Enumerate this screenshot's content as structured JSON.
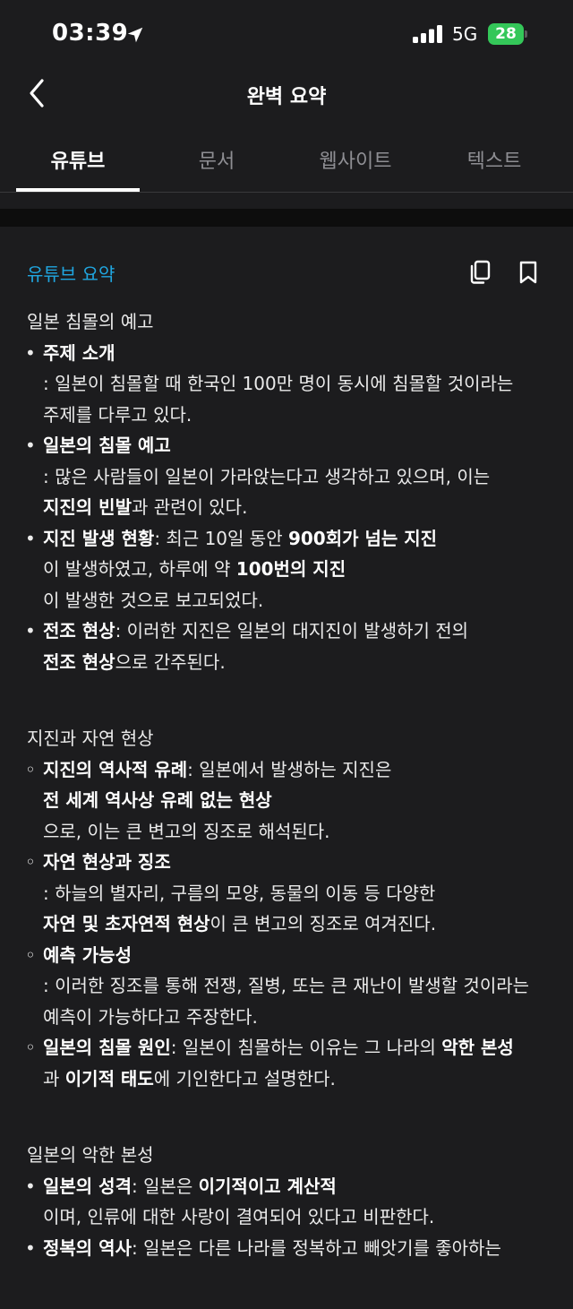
{
  "status_bar": {
    "time": "03:39",
    "network": "5G",
    "battery": "28"
  },
  "nav": {
    "title": "완벽 요약"
  },
  "tabs": [
    {
      "label": "유튜브",
      "active": true
    },
    {
      "label": "문서",
      "active": false
    },
    {
      "label": "웹사이트",
      "active": false
    },
    {
      "label": "텍스트",
      "active": false
    }
  ],
  "summary": {
    "section_title": "유튜브 요약",
    "groups": [
      {
        "title": "일본 침몰의 예고",
        "bullet": "•",
        "items": [
          {
            "lines": [
              [
                {
                  "t": "주제 소개",
                  "b": true
                }
              ],
              [
                {
                  "t": ": 일본이 침몰할 때 한국인 100만 명이 동시에 침몰할 것이라는"
                }
              ],
              [
                {
                  "t": "주제를 다루고 있다."
                }
              ]
            ]
          },
          {
            "lines": [
              [
                {
                  "t": "일본의 침몰 예고",
                  "b": true
                }
              ],
              [
                {
                  "t": ": 많은 사람들이 일본이 가라앉는다고 생각하고 있으며, 이는"
                }
              ],
              [
                {
                  "t": "지진의 빈발",
                  "b": true
                },
                {
                  "t": "과 관련이 있다."
                }
              ]
            ]
          },
          {
            "lines": [
              [
                {
                  "t": "지진 발생 현황",
                  "b": true
                },
                {
                  "t": ": 최근 10일 동안 "
                },
                {
                  "t": "900회가 넘는 지진",
                  "b": true
                }
              ],
              [
                {
                  "t": "이 발생하였고, 하루에 약 "
                },
                {
                  "t": "100번의 지진",
                  "b": true
                }
              ],
              [
                {
                  "t": "이 발생한 것으로 보고되었다."
                }
              ]
            ]
          },
          {
            "lines": [
              [
                {
                  "t": "전조 현상",
                  "b": true
                },
                {
                  "t": ": 이러한 지진은 일본의 대지진이 발생하기 전의"
                }
              ],
              [
                {
                  "t": "전조 현상",
                  "b": true
                },
                {
                  "t": "으로 간주된다."
                }
              ]
            ]
          }
        ]
      },
      {
        "title": "지진과 자연 현상",
        "bullet": "◦",
        "items": [
          {
            "lines": [
              [
                {
                  "t": "지진의 역사적 유례",
                  "b": true
                },
                {
                  "t": ": 일본에서 발생하는 지진은"
                }
              ],
              [
                {
                  "t": "전 세계 역사상 유례 없는 현상",
                  "b": true
                }
              ],
              [
                {
                  "t": "으로, 이는 큰 변고의 징조로 해석된다."
                }
              ]
            ]
          },
          {
            "lines": [
              [
                {
                  "t": "자연 현상과 징조",
                  "b": true
                }
              ],
              [
                {
                  "t": ": 하늘의 별자리, 구름의 모양, 동물의 이동 등 다양한"
                }
              ],
              [
                {
                  "t": "자연 및 초자연적 현상",
                  "b": true
                },
                {
                  "t": "이 큰 변고의 징조로 여겨진다."
                }
              ]
            ]
          },
          {
            "lines": [
              [
                {
                  "t": "예측 가능성",
                  "b": true
                }
              ],
              [
                {
                  "t": ": 이러한 징조를 통해 전쟁, 질병, 또는 큰 재난이 발생할 것이라는"
                }
              ],
              [
                {
                  "t": "예측이 가능하다고 주장한다."
                }
              ]
            ]
          },
          {
            "lines": [
              [
                {
                  "t": "일본의 침몰 원인",
                  "b": true
                },
                {
                  "t": ": 일본이 침몰하는 이유는 그 나라의 "
                },
                {
                  "t": "악한 본성",
                  "b": true
                }
              ],
              [
                {
                  "t": "과 "
                },
                {
                  "t": "이기적 태도",
                  "b": true
                },
                {
                  "t": "에 기인한다고 설명한다."
                }
              ]
            ]
          }
        ]
      },
      {
        "title": "일본의 악한 본성",
        "bullet": "•",
        "items": [
          {
            "lines": [
              [
                {
                  "t": "일본의 성격",
                  "b": true
                },
                {
                  "t": ": 일본은 "
                },
                {
                  "t": "이기적이고 계산적",
                  "b": true
                }
              ],
              [
                {
                  "t": "이며, 인류에 대한 사랑이 결여되어 있다고 비판한다."
                }
              ]
            ]
          },
          {
            "lines": [
              [
                {
                  "t": "정복의 역사",
                  "b": true
                },
                {
                  "t": ": 일본은 다른 나라를 정복하고 빼앗기를 좋아하는"
                }
              ]
            ]
          }
        ]
      }
    ]
  }
}
